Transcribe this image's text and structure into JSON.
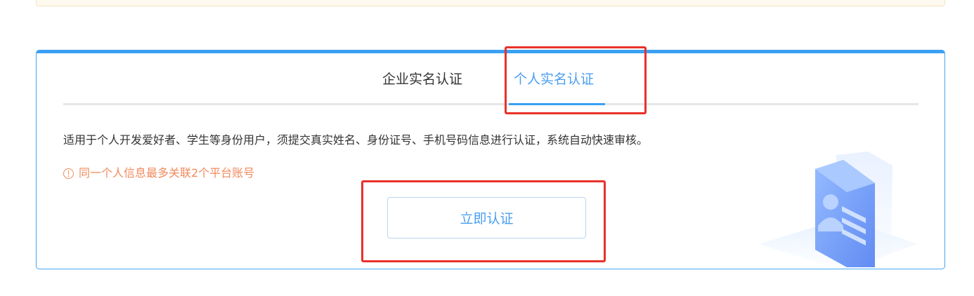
{
  "tabs": [
    {
      "label": "企业实名认证",
      "active": false
    },
    {
      "label": "个人实名认证",
      "active": true
    }
  ],
  "description": "适用于个人开发爱好者、学生等身份用户，须提交真实姓名、身份证号、手机号码信息进行认证，系统自动快速审核。",
  "warning": "同一个人信息最多关联2个平台账号",
  "verify_button": "立即认证",
  "colors": {
    "accent": "#3aa0f3",
    "warning": "#f08a5d",
    "highlight": "#e8312a"
  },
  "icons": {
    "warning": "info-circle-icon",
    "illustration": "id-card-illustration"
  }
}
